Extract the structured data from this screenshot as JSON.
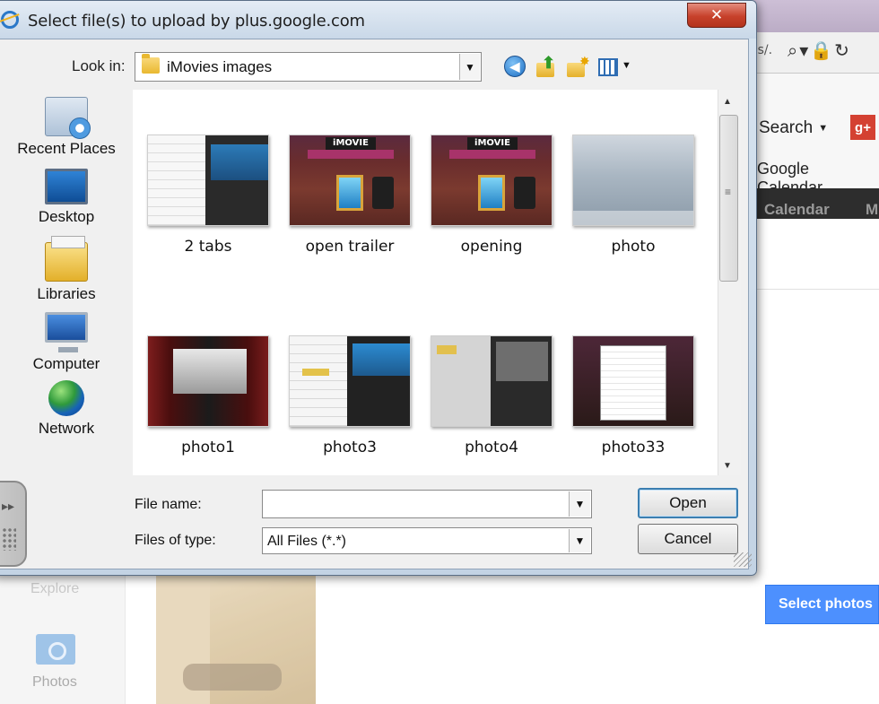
{
  "browser_bg": {
    "url_fragment": "os/.",
    "search_label": "Search",
    "gplus_label": "g+",
    "gcal_label": "Google Calendar",
    "calendar_tab": "Calendar",
    "next_tab": "M",
    "explore_label": "Explore",
    "photos_label": "Photos",
    "select_photos_label": "Select photos"
  },
  "dialog": {
    "title": "Select file(s) to upload by plus.google.com",
    "close_label": "✕",
    "look_in_label": "Look in:",
    "look_in_value": "iMovies images",
    "places": [
      {
        "label": "Recent Places",
        "icon": "recent-places-icon"
      },
      {
        "label": "Desktop",
        "icon": "desktop-icon"
      },
      {
        "label": "Libraries",
        "icon": "libraries-icon"
      },
      {
        "label": "Computer",
        "icon": "computer-icon"
      },
      {
        "label": "Network",
        "icon": "network-icon"
      }
    ],
    "files": [
      {
        "name": "2 tabs"
      },
      {
        "name": "open trailer"
      },
      {
        "name": "opening"
      },
      {
        "name": "photo"
      },
      {
        "name": "photo1"
      },
      {
        "name": "photo3"
      },
      {
        "name": "photo4"
      },
      {
        "name": "photo33"
      }
    ],
    "thumb_text": {
      "imovie_title": "iMOVIE"
    },
    "file_name_label": "File name:",
    "file_name_value": "",
    "files_of_type_label": "Files of type:",
    "files_of_type_value": "All Files (*.*)",
    "open_label": "Open",
    "cancel_label": "Cancel"
  }
}
